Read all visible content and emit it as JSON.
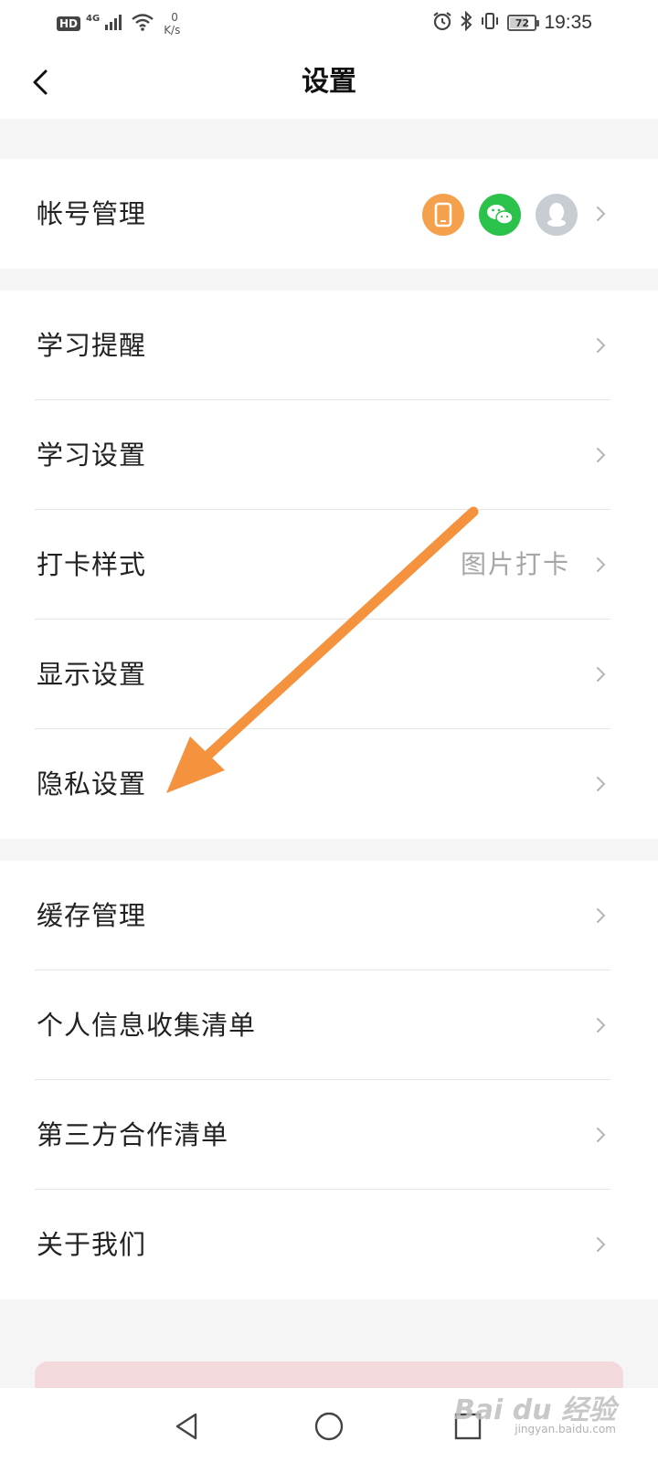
{
  "status_bar": {
    "network_badge": "HD",
    "network_type": "4G",
    "speed_value": "0",
    "speed_unit": "K/s",
    "battery_level": "72",
    "battery_fraction": 0.72,
    "time": "19:35",
    "icons": [
      "signal-icon",
      "wifi-icon",
      "alarm-icon",
      "bluetooth-icon",
      "vibrate-icon",
      "battery-icon"
    ]
  },
  "header": {
    "title": "设置",
    "back_icon": "chevron-left-icon"
  },
  "account_group": {
    "items": [
      {
        "label": "帐号管理",
        "icons": [
          {
            "name": "phone-icon",
            "color": "#f5a04d"
          },
          {
            "name": "wechat-icon",
            "color": "#2ac24a"
          },
          {
            "name": "qq-icon",
            "color": "#c8cdd4"
          }
        ]
      }
    ]
  },
  "study_group": {
    "items": [
      {
        "label": "学习提醒"
      },
      {
        "label": "学习设置"
      },
      {
        "label": "打卡样式",
        "value": "图片打卡"
      },
      {
        "label": "显示设置"
      },
      {
        "label": "隐私设置"
      }
    ]
  },
  "other_group": {
    "items": [
      {
        "label": "缓存管理"
      },
      {
        "label": "个人信息收集清单"
      },
      {
        "label": "第三方合作清单"
      },
      {
        "label": "关于我们"
      }
    ]
  },
  "nav_bar": {
    "buttons": [
      "back-triangle-icon",
      "home-circle-icon",
      "recents-square-icon"
    ]
  },
  "watermark": {
    "text": "Bai du 经验",
    "sub": "jingyan.baidu.com"
  },
  "colors": {
    "annotation_arrow": "#f5923e",
    "logout_bg": "#f3d9dc",
    "value_text": "#a6a6a6"
  }
}
